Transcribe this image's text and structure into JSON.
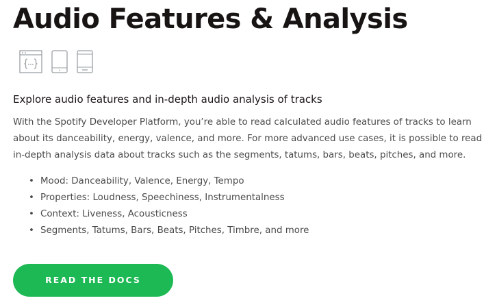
{
  "header": {
    "title": "Audio Features & Analysis"
  },
  "platforms": {
    "icons": [
      "web-api-icon",
      "tablet-icon",
      "mobile-icon"
    ]
  },
  "content": {
    "subtitle": "Explore audio features and in-depth audio analysis of tracks",
    "description": "With the Spotify Developer Platform, you’re able to read calculated audio features of tracks to learn about its danceability, energy, valence, and more. For more advanced use cases, it is possible to read in-depth analysis data about tracks such as the segments, tatums, bars, beats, pitches, and more.",
    "bullet_glyph": "•",
    "features": [
      "Mood: Danceability, Valence, Energy, Tempo",
      "Properties: Loudness, Speechiness, Instrumentalness",
      "Context: Liveness, Acousticness",
      "Segments, Tatums, Bars, Beats, Pitches, Timbre, and more"
    ]
  },
  "cta": {
    "label": "READ THE DOCS"
  },
  "colors": {
    "accent": "#1db954",
    "title": "#191414",
    "body_text": "#4a4a4a",
    "icon_stroke": "#9aa0a3"
  }
}
